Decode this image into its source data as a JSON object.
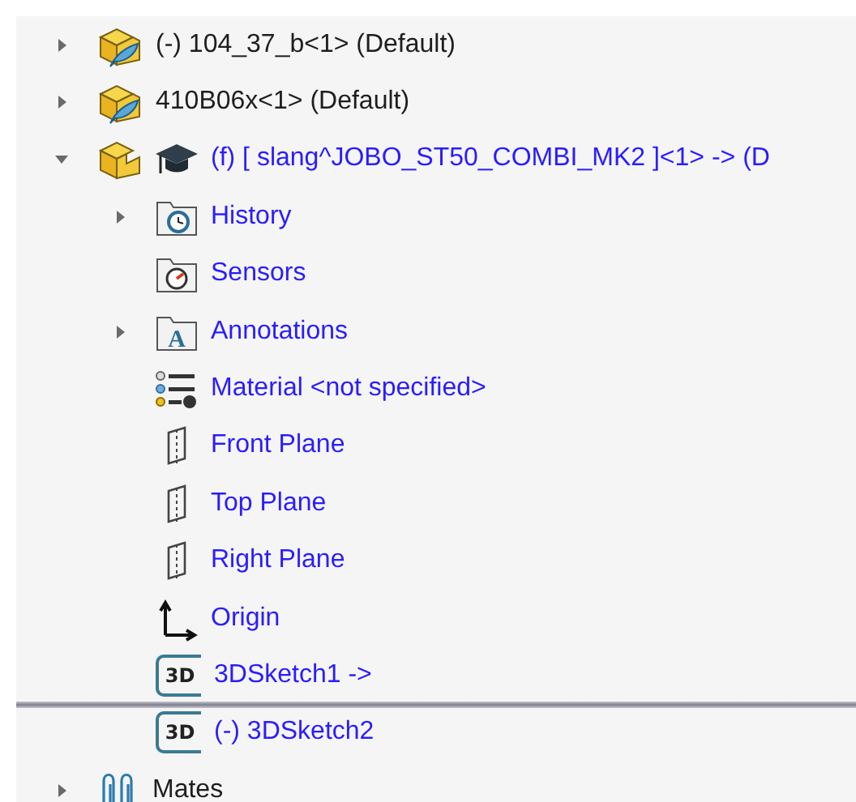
{
  "tree": {
    "items": [
      {
        "kind": "part",
        "label": "(-) 104_37_b<1> (Default)",
        "color": "#1e1e1e",
        "expanded": false
      },
      {
        "kind": "part",
        "label": "410B06x<1> (Default)",
        "color": "#1e1e1e",
        "expanded": false
      },
      {
        "kind": "part-cap",
        "label": "(f) [ slang^JOBO_ST50_COMBI_MK2 ]<1> -> (D",
        "color": "#2a1cff",
        "expanded": true,
        "children": [
          {
            "kind": "history",
            "label": "History",
            "color": "#2a1cff",
            "expanded": false
          },
          {
            "kind": "sensors",
            "label": "Sensors",
            "color": "#2a1cff"
          },
          {
            "kind": "annotations",
            "label": "Annotations",
            "color": "#2a1cff",
            "expanded": false,
            "icon_text": "A"
          },
          {
            "kind": "material",
            "label": "Material <not specified>",
            "color": "#2a1cff"
          },
          {
            "kind": "plane",
            "label": "Front Plane",
            "color": "#2a1cff"
          },
          {
            "kind": "plane",
            "label": "Top Plane",
            "color": "#2a1cff"
          },
          {
            "kind": "plane",
            "label": "Right Plane",
            "color": "#2a1cff"
          },
          {
            "kind": "origin",
            "label": "Origin",
            "color": "#2a1cff"
          },
          {
            "kind": "sketch3d",
            "label": "3DSketch1 ->",
            "color": "#2a1cff",
            "icon_text": "3D"
          },
          {
            "kind": "rollback"
          },
          {
            "kind": "sketch3d",
            "label": "(-) 3DSketch2",
            "color": "#2a1cff",
            "icon_text": "3D"
          }
        ]
      },
      {
        "kind": "mates",
        "label": "Mates",
        "color": "#1e1e1e",
        "expanded": false
      }
    ]
  }
}
